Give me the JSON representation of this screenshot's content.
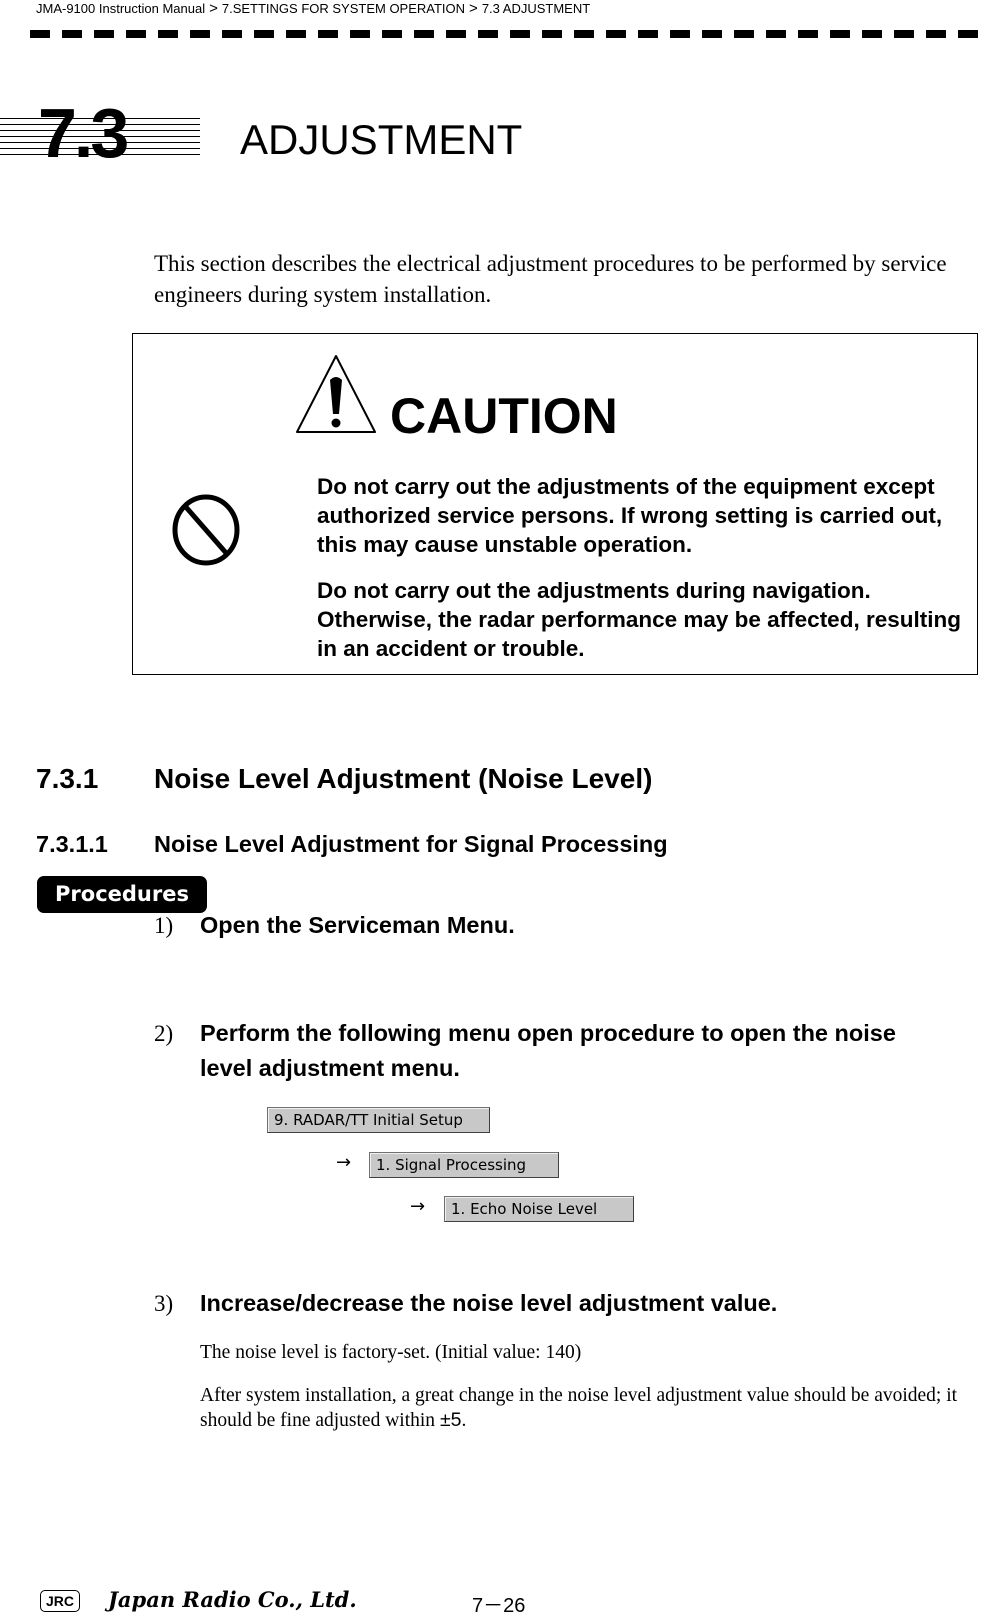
{
  "breadcrumb": {
    "items": [
      "JMA-9100 Instruction Manual",
      "7.SETTINGS FOR SYSTEM OPERATION",
      "7.3  ADJUSTMENT"
    ],
    "separator": ">"
  },
  "section": {
    "number": "7.3",
    "title": "ADJUSTMENT",
    "intro": "This section describes the electrical adjustment procedures to be performed by service engineers during system installation."
  },
  "caution": {
    "heading": "CAUTION",
    "warning_icon": "warning-triangle-icon",
    "prohibit_icon": "prohibition-icon",
    "paragraphs": [
      "Do not carry out the adjustments of the equipment except authorized service persons. If wrong setting is carried out, this may cause unstable operation.",
      "Do not carry out the adjustments during navigation. Otherwise, the radar performance may be affected, resulting in an accident or trouble."
    ]
  },
  "subsection": {
    "number": "7.3.1",
    "title": "Noise Level Adjustment (Noise Level)"
  },
  "subsubsection": {
    "number": "7.3.1.1",
    "title": "Noise Level Adjustment for Signal Processing"
  },
  "procedures_label": "Procedures",
  "steps": [
    {
      "num": "1)",
      "text": "Open the Serviceman Menu."
    },
    {
      "num": "2)",
      "text": "Perform the following menu open procedure to open the noise level adjustment menu."
    },
    {
      "num": "3)",
      "text": "Increase/decrease the noise level adjustment value."
    }
  ],
  "menu_path": {
    "arrow": "→",
    "buttons": [
      "9. RADAR/TT Initial Setup",
      "1. Signal Processing",
      "1. Echo Noise Level"
    ]
  },
  "notes": {
    "factory": "The noise level is factory-set. (Initial value: 140)",
    "fine_adjust_prefix": "After system installation, a great change in the noise level adjustment value should be avoided; it should be fine adjusted within ",
    "fine_adjust_value": "±5",
    "fine_adjust_suffix": "."
  },
  "footer": {
    "logo_mark": "JRC",
    "company": "Japan Radio Co., Ltd.",
    "page": "7－26"
  }
}
